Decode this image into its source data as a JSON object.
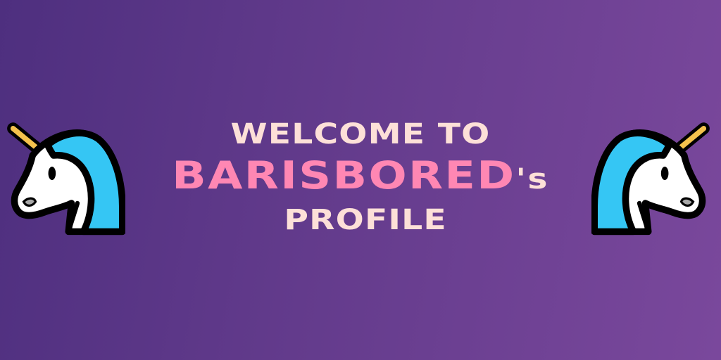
{
  "banner": {
    "line1": "WELCOME TO",
    "name": "BARISBORED",
    "possessive": "'s",
    "line3": "PROFILE"
  },
  "icons": {
    "left": "unicorn-icon",
    "right": "unicorn-icon"
  },
  "colors": {
    "background_start": "#4e2f7f",
    "background_end": "#7a489c",
    "text_light": "#fde0d8",
    "name_pink": "#ff87b3",
    "unicorn_mane": "#35c6f4",
    "unicorn_horn": "#f4c24d"
  }
}
